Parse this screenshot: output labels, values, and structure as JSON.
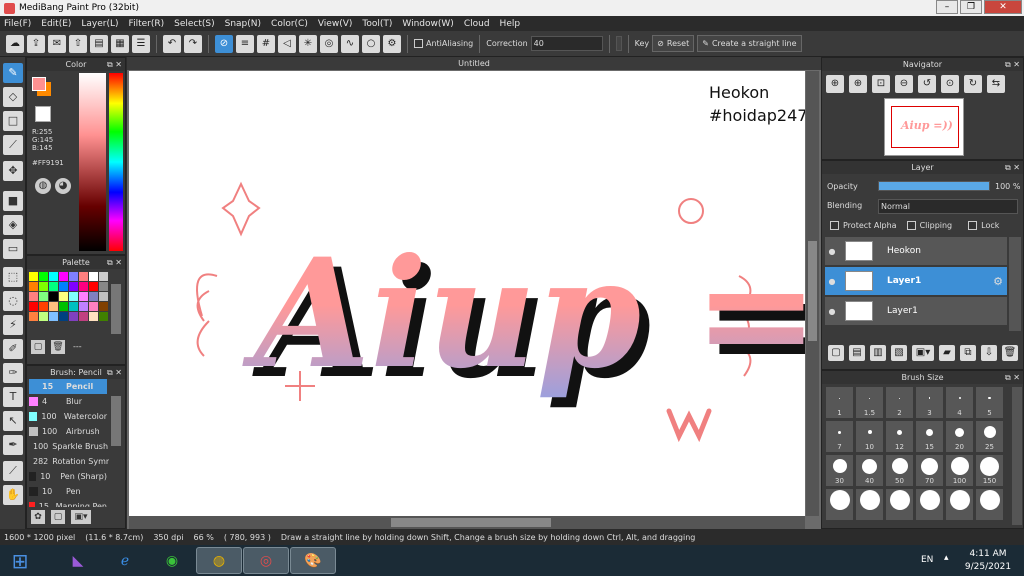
{
  "window": {
    "title": "MediBang Paint Pro (32bit)"
  },
  "menu": [
    "File(F)",
    "Edit(E)",
    "Layer(L)",
    "Filter(R)",
    "Select(S)",
    "Snap(N)",
    "Color(C)",
    "View(V)",
    "Tool(T)",
    "Window(W)",
    "Cloud",
    "Help"
  ],
  "toolbar": {
    "antialiasing_label": "AntiAliasing",
    "antialiasing_checked": true,
    "correction_label": "Correction",
    "correction_value": "40",
    "key_label": "Key",
    "reset_label": "Reset",
    "straight_line_label": "Create a straight line"
  },
  "color_panel": {
    "title": "Color",
    "r": "R:255",
    "g": "G:145",
    "b": "B:145",
    "hex": "#FF9191",
    "primary_color": "#ff9191",
    "secondary_color": "#ff8a00"
  },
  "palette_panel": {
    "title": "Palette",
    "footer_text": "---",
    "colors": [
      "#ffff00",
      "#00ff00",
      "#00ffff",
      "#ff00ff",
      "#8080ff",
      "#ff8080",
      "#ffffff",
      "#cccccc",
      "#ff8000",
      "#80ff00",
      "#00ff80",
      "#0080ff",
      "#8000ff",
      "#ff0080",
      "#ff0000",
      "#888888",
      "#ff8080",
      "#80ff80",
      "#000000",
      "#ffff80",
      "#80ffff",
      "#ff80ff",
      "#8080c0",
      "#c0c0c0",
      "#ff0000",
      "#ff4000",
      "#ffc080",
      "#00c000",
      "#00c0c0",
      "#c080ff",
      "#ff80c0",
      "#804000",
      "#ff8040",
      "#c0ff80",
      "#80c0ff",
      "#004080",
      "#8040c0",
      "#c04080",
      "#ffe0c0",
      "#408000"
    ]
  },
  "brush_panel": {
    "title": "Brush: Pencil",
    "items": [
      {
        "size": "15",
        "name": "Pencil",
        "color": "#3d8fd6",
        "selected": true
      },
      {
        "size": "4",
        "name": "Blur",
        "color": "#ff80ff"
      },
      {
        "size": "100",
        "name": "Watercolor",
        "color": "#80ffff"
      },
      {
        "size": "100",
        "name": "Airbrush",
        "color": "#c0c0c0"
      },
      {
        "size": "100",
        "name": "Sparkle Brush",
        "color": "#4040ff"
      },
      {
        "size": "282",
        "name": "Rotation Symmetry",
        "color": "#ff4040"
      },
      {
        "size": "10",
        "name": "Pen (Sharp)",
        "color": "#222222"
      },
      {
        "size": "10",
        "name": "Pen",
        "color": "#222222"
      },
      {
        "size": "15",
        "name": "Mapping Pen",
        "color": "#ff2020"
      }
    ]
  },
  "canvas": {
    "tab_title": "Untitled",
    "watermark_line1": "Heokon",
    "watermark_line2": "#hoidap247",
    "artwork_text": "Aiup =))"
  },
  "navigator": {
    "title": "Navigator",
    "preview_text": "Aiup =))"
  },
  "layer_panel": {
    "title": "Layer",
    "opacity_label": "Opacity",
    "opacity_value": "100 %",
    "opacity_fraction": 1.0,
    "blending_label": "Blending",
    "blending_value": "Normal",
    "protect_alpha": "Protect Alpha",
    "clipping": "Clipping",
    "lock": "Lock",
    "layers": [
      {
        "name": "Heokon",
        "selected": false
      },
      {
        "name": "Layer1",
        "selected": true
      },
      {
        "name": "Layer1",
        "selected": false
      }
    ]
  },
  "brush_size_panel": {
    "title": "Brush Size",
    "row1": [
      ".",
      ".",
      ".",
      ".",
      ".",
      "."
    ],
    "row1_labels": [
      "1",
      "1.5",
      "2",
      "3",
      "4",
      "5"
    ],
    "row2_labels": [
      "7",
      "10",
      "12",
      "15",
      "20",
      "25"
    ],
    "row3_labels": [
      "30",
      "40",
      "50",
      "70",
      "100",
      "150"
    ]
  },
  "statusbar": {
    "size": "1600 * 1200 pixel",
    "cm": "(11.6 * 8.7cm)",
    "dpi": "350 dpi",
    "zoom": "66 %",
    "coords": "( 780, 993 )",
    "hint": "Draw a straight line by holding down Shift, Change a brush size by holding down Ctrl, Alt, and dragging"
  },
  "taskbar": {
    "lang": "EN",
    "time": "4:11 AM",
    "date": "9/25/2021"
  }
}
